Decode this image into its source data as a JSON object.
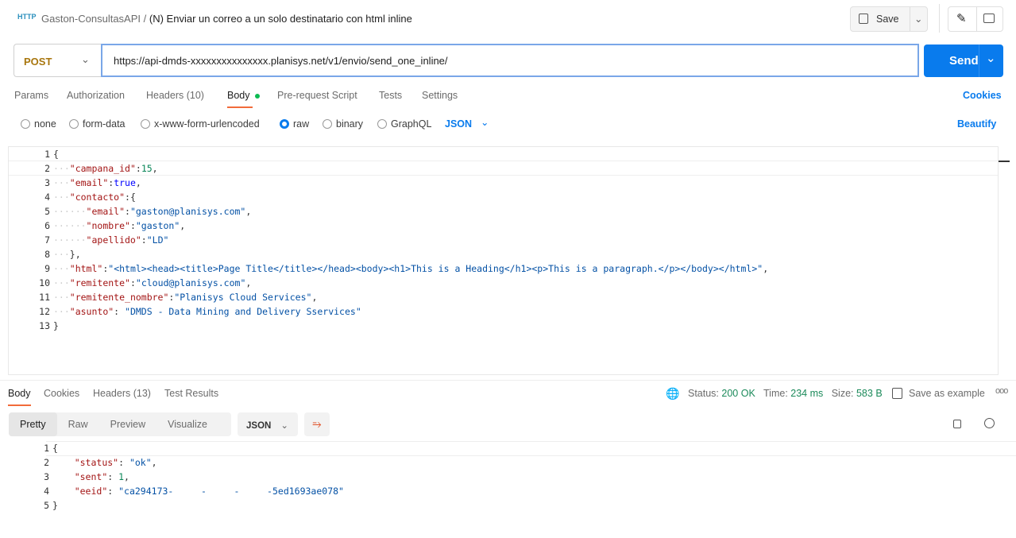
{
  "header": {
    "icon": "http-icon",
    "collection": "Gaston-ConsultasAPI",
    "separator": "/",
    "request_name": "(N) Enviar un correo a un solo destinatario con html inline",
    "save_label": "Save"
  },
  "request": {
    "method": "POST",
    "url": "https://api-dmds-xxxxxxxxxxxxxxx.planisys.net/v1/envio/send_one_inline/",
    "send_label": "Send"
  },
  "tabs": [
    {
      "label": "Params"
    },
    {
      "label": "Authorization"
    },
    {
      "label": "Headers (10)"
    },
    {
      "label": "Body",
      "active": true
    },
    {
      "label": "Pre-request Script"
    },
    {
      "label": "Tests"
    },
    {
      "label": "Settings"
    }
  ],
  "cookies_label": "Cookies",
  "body_types": [
    {
      "label": "none"
    },
    {
      "label": "form-data"
    },
    {
      "label": "x-www-form-urlencoded"
    },
    {
      "label": "raw",
      "selected": true
    },
    {
      "label": "binary"
    },
    {
      "label": "GraphQL"
    }
  ],
  "format": "JSON",
  "beautify_label": "Beautify",
  "request_body": [
    [
      [
        "p",
        "{"
      ]
    ],
    [
      [
        "w",
        "···"
      ],
      [
        "k",
        "\"campana_id\""
      ],
      [
        "p",
        ":"
      ],
      [
        "n",
        "15"
      ],
      [
        "p",
        ","
      ]
    ],
    [
      [
        "w",
        "···"
      ],
      [
        "k",
        "\"email\""
      ],
      [
        "p",
        ":"
      ],
      [
        "b",
        "true"
      ],
      [
        "p",
        ","
      ]
    ],
    [
      [
        "w",
        "···"
      ],
      [
        "k",
        "\"contacto\""
      ],
      [
        "p",
        ":{"
      ]
    ],
    [
      [
        "w",
        "······"
      ],
      [
        "k",
        "\"email\""
      ],
      [
        "p",
        ":"
      ],
      [
        "s",
        "\"gaston@planisys.com\""
      ],
      [
        "p",
        ","
      ]
    ],
    [
      [
        "w",
        "······"
      ],
      [
        "k",
        "\"nombre\""
      ],
      [
        "p",
        ":"
      ],
      [
        "s",
        "\"gaston\""
      ],
      [
        "p",
        ","
      ]
    ],
    [
      [
        "w",
        "······"
      ],
      [
        "k",
        "\"apellido\""
      ],
      [
        "p",
        ":"
      ],
      [
        "s",
        "\"LD\""
      ]
    ],
    [
      [
        "w",
        "···"
      ],
      [
        "p",
        "},"
      ]
    ],
    [
      [
        "w",
        "···"
      ],
      [
        "k",
        "\"html\""
      ],
      [
        "p",
        ":"
      ],
      [
        "s",
        "\"<html><head><title>Page Title</title></head><body><h1>This is a Heading</h1><p>This is a paragraph.</p></body></html>\""
      ],
      [
        "p",
        ","
      ]
    ],
    [
      [
        "w",
        "···"
      ],
      [
        "k",
        "\"remitente\""
      ],
      [
        "p",
        ":"
      ],
      [
        "s",
        "\"cloud@planisys.com\""
      ],
      [
        "p",
        ","
      ]
    ],
    [
      [
        "w",
        "···"
      ],
      [
        "k",
        "\"remitente_nombre\""
      ],
      [
        "p",
        ":"
      ],
      [
        "s",
        "\"Planisys Cloud Services\""
      ],
      [
        "p",
        ","
      ]
    ],
    [
      [
        "w",
        "···"
      ],
      [
        "k",
        "\"asunto\""
      ],
      [
        "p",
        ": "
      ],
      [
        "s",
        "\"DMDS - Data Mining and Delivery Sservices\""
      ]
    ],
    [
      [
        "p",
        "}"
      ]
    ]
  ],
  "response": {
    "tabs": [
      {
        "label": "Body",
        "active": true
      },
      {
        "label": "Cookies"
      },
      {
        "label": "Headers (13)"
      },
      {
        "label": "Test Results"
      }
    ],
    "status_label": "Status:",
    "status": "200 OK",
    "time_label": "Time:",
    "time": "234 ms",
    "size_label": "Size:",
    "size": "583 B",
    "save_example": "Save as example",
    "views": [
      {
        "label": "Pretty",
        "active": true
      },
      {
        "label": "Raw"
      },
      {
        "label": "Preview"
      },
      {
        "label": "Visualize"
      }
    ],
    "format": "JSON",
    "body": [
      [
        [
          "p",
          "{"
        ]
      ],
      [
        [
          "p",
          "    "
        ],
        [
          "k",
          "\"status\""
        ],
        [
          "p",
          ": "
        ],
        [
          "s",
          "\"ok\""
        ],
        [
          "p",
          ","
        ]
      ],
      [
        [
          "p",
          "    "
        ],
        [
          "k",
          "\"sent\""
        ],
        [
          "p",
          ": "
        ],
        [
          "n",
          "1"
        ],
        [
          "p",
          ","
        ]
      ],
      [
        [
          "p",
          "    "
        ],
        [
          "k",
          "\"eeid\""
        ],
        [
          "p",
          ": "
        ],
        [
          "s",
          "\"ca294173-     -     -     -5ed1693ae078\""
        ]
      ],
      [
        [
          "p",
          "}"
        ]
      ]
    ]
  },
  "colors": {
    "accent": "#097bed",
    "tab_underline": "#f26b3a",
    "status_green": "#1b8a5a",
    "method": "#a8760e"
  }
}
